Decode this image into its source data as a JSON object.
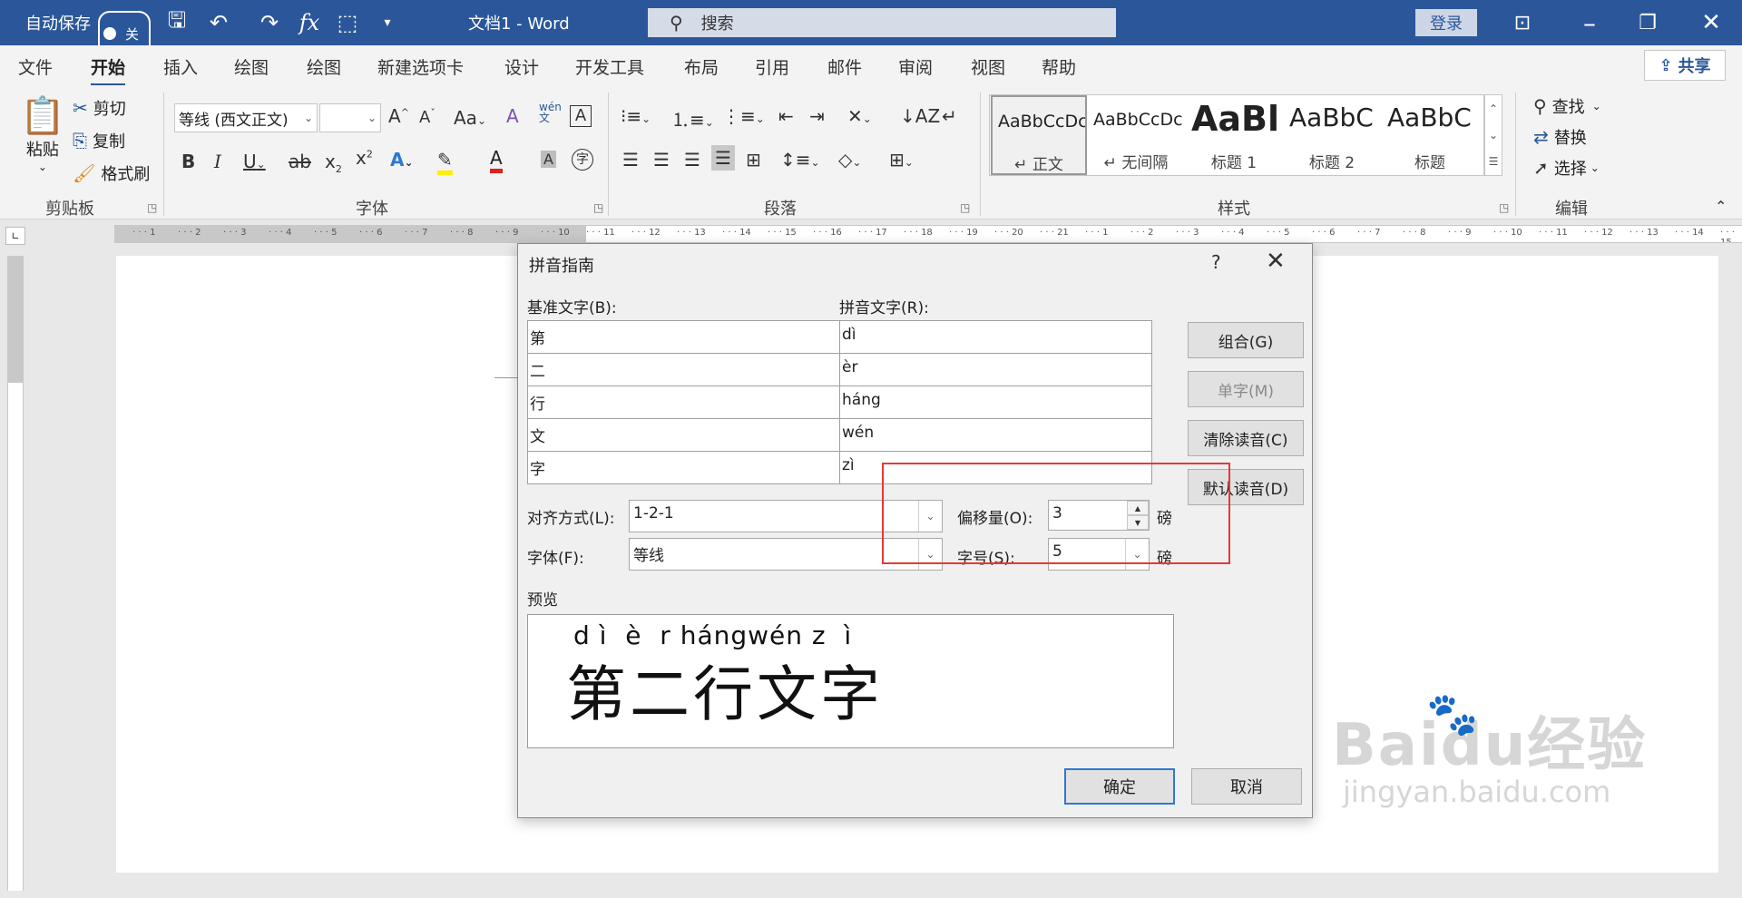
{
  "titlebar": {
    "autosave_label": "自动保存",
    "autosave_state": "关",
    "doc_title": "文档1  -  Word",
    "search_placeholder": "搜索",
    "login": "登录"
  },
  "tabs": [
    "文件",
    "开始",
    "插入",
    "绘图",
    "绘图",
    "新建选项卡",
    "设计",
    "开发工具",
    "布局",
    "引用",
    "邮件",
    "审阅",
    "视图",
    "帮助"
  ],
  "active_tab": "开始",
  "share": "共享",
  "clipboard": {
    "paste": "粘贴",
    "cut": "剪切",
    "copy": "复制",
    "format_painter": "格式刷",
    "label": "剪贴板"
  },
  "font": {
    "font_name": "等线 (西文正文)",
    "font_size": "",
    "label": "字体"
  },
  "paragraph": {
    "label": "段落"
  },
  "styles": {
    "label": "样式",
    "items": [
      {
        "sample": "AaBbCcDc",
        "name": "↵ 正文"
      },
      {
        "sample": "AaBbCcDc",
        "name": "↵ 无间隔"
      },
      {
        "sample": "AaBl",
        "name": "标题 1"
      },
      {
        "sample": "AaBbC",
        "name": "标题 2"
      },
      {
        "sample": "AaBbC",
        "name": "标题"
      }
    ]
  },
  "editing": {
    "find": "查找",
    "replace": "替换",
    "select": "选择",
    "label": "编辑"
  },
  "dialog": {
    "title": "拼音指南",
    "help": "?",
    "base_label": "基准文字(B):",
    "ruby_label": "拼音文字(R):",
    "rows": [
      {
        "base": "第",
        "ruby": "dì"
      },
      {
        "base": "二",
        "ruby": "èr"
      },
      {
        "base": "行",
        "ruby": "háng"
      },
      {
        "base": "文",
        "ruby": "wén"
      },
      {
        "base": "字",
        "ruby": "zì"
      }
    ],
    "buttons": {
      "group": "组合(G)",
      "mono": "单字(M)",
      "clear": "清除读音(C)",
      "default": "默认读音(D)"
    },
    "alignment_label": "对齐方式(L):",
    "alignment_value": "1-2-1",
    "offset_label": "偏移量(O):",
    "offset_value": "3",
    "offset_unit": "磅",
    "font_label": "字体(F):",
    "font_value": "等线",
    "size_label": "字号(S):",
    "size_value": "5",
    "size_unit": "磅",
    "preview_label": "预览",
    "preview_pinyin": "d ì  è  r hángwén z  ì",
    "preview_text": "第二行文字",
    "ok": "确定",
    "cancel": "取消"
  },
  "watermark": {
    "logo": "Baidu经验",
    "url": "jingyan.baidu.com"
  }
}
